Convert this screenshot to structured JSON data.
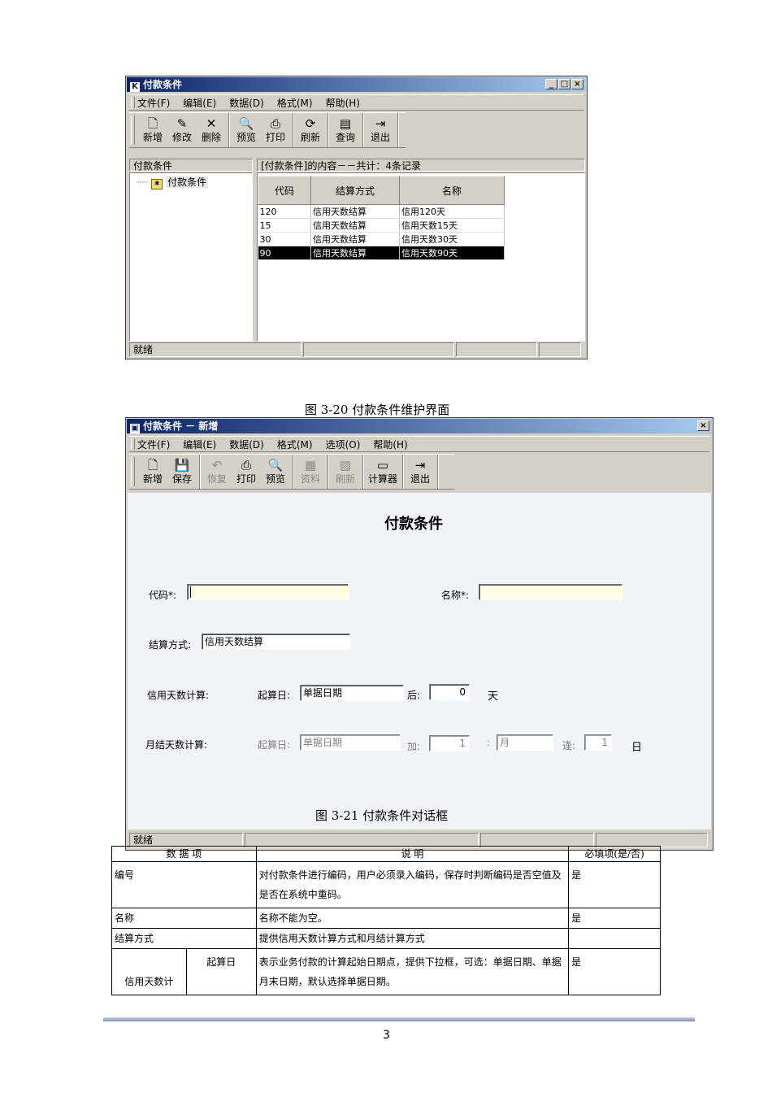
{
  "window1": {
    "title": "付款条件",
    "title_icon": "K",
    "window_buttons": [
      "_",
      "□",
      "×"
    ],
    "menu": [
      "文件(F)",
      "编辑(E)",
      "数据(D)",
      "格式(M)",
      "帮助(H)"
    ],
    "toolbar": [
      [
        {
          "icon": "new-icon",
          "glyph": "🗋",
          "label": "新增"
        },
        {
          "icon": "edit-icon",
          "glyph": "✎",
          "label": "修改"
        },
        {
          "icon": "delete-icon",
          "glyph": "✕",
          "label": "删除"
        }
      ],
      [
        {
          "icon": "preview-icon",
          "glyph": "🔍",
          "label": "预览"
        },
        {
          "icon": "print-icon",
          "glyph": "⎙",
          "label": "打印"
        }
      ],
      [
        {
          "icon": "refresh-icon",
          "glyph": "⟳",
          "label": "刷新"
        }
      ],
      [
        {
          "icon": "query-icon",
          "glyph": "▤",
          "label": "查询"
        }
      ],
      [
        {
          "icon": "exit-icon",
          "glyph": "⇥",
          "label": "退出"
        }
      ]
    ],
    "left_panel_title": "付款条件",
    "tree_item": "付款条件",
    "right_panel_title": "[付款条件]的内容－－共计：4条记录",
    "grid": {
      "columns": [
        "代码",
        "结算方式",
        "名称"
      ],
      "rows": [
        [
          "120",
          "信用天数结算",
          "信用120天"
        ],
        [
          "15",
          "信用天数结算",
          "信用天数15天"
        ],
        [
          "30",
          "信用天数结算",
          "信用天数30天"
        ],
        [
          "90",
          "信用天数结算",
          "信用天数90天"
        ]
      ],
      "selected_row": 3
    },
    "status": "就绪"
  },
  "caption1": "图 3-20 付款条件维护界面",
  "window2": {
    "title": "付款条件 － 新增",
    "close": "×",
    "menu": [
      "文件(F)",
      "编辑(E)",
      "数据(D)",
      "格式(M)",
      "选项(O)",
      "帮助(H)"
    ],
    "toolbar": [
      [
        {
          "icon": "new-icon",
          "glyph": "🗋",
          "label": "新增",
          "enabled": true
        },
        {
          "icon": "save-icon",
          "glyph": "💾",
          "label": "保存",
          "enabled": true
        }
      ],
      [
        {
          "icon": "undo-icon",
          "glyph": "↶",
          "label": "恢复",
          "enabled": false
        },
        {
          "icon": "print-icon",
          "glyph": "⎙",
          "label": "打印",
          "enabled": true
        },
        {
          "icon": "preview-icon",
          "glyph": "🔍",
          "label": "预览",
          "enabled": true
        }
      ],
      [
        {
          "icon": "info-icon",
          "glyph": "▦",
          "label": "资料",
          "enabled": false
        }
      ],
      [
        {
          "icon": "refresh-icon",
          "glyph": "▧",
          "label": "刷新",
          "enabled": false
        }
      ],
      [
        {
          "icon": "calculator-icon",
          "glyph": "▭",
          "label": "计算器",
          "enabled": true
        }
      ],
      [
        {
          "icon": "exit-icon",
          "glyph": "⇥",
          "label": "退出",
          "enabled": true
        }
      ]
    ],
    "form_title": "付款条件",
    "code_label": "代码*:",
    "code_value": "",
    "name_label": "名称*:",
    "name_value": "",
    "settle_label": "结算方式:",
    "settle_value": "信用天数结算",
    "credit_label": "信用天数计算:",
    "credit_start_label": "起算日:",
    "credit_start_value": "单据日期",
    "credit_after_label": "后:",
    "credit_days_value": "0",
    "credit_unit": "天",
    "month_label": "月结天数计算:",
    "month_start_label": "起算日:",
    "month_start_value": "单据日期",
    "month_add_label": "加:",
    "month_add_value": "1",
    "month_colon": ":",
    "month_unit_value": "月",
    "month_reach_label": "逢:",
    "month_reach_value": "1",
    "month_day_unit": "日",
    "status": "就绪"
  },
  "caption2": "图 3-21 付款条件对话框",
  "doc_table": {
    "headers": [
      "数 据 项",
      "说 明",
      "必填项(是/否)"
    ],
    "rows": [
      {
        "item": "编号",
        "desc": "对付款条件进行编码，用户必须录入编码，保存时判断编码是否空值及是否在系统中重码。",
        "req": "是"
      },
      {
        "item": "名称",
        "desc": "名称不能为空。",
        "req": "是"
      },
      {
        "item": "结算方式",
        "desc": "提供信用天数计算方式和月结计算方式",
        "req": ""
      }
    ],
    "last_row": {
      "group": "信用天数计",
      "sub": "起算日",
      "desc": "表示业务付款的计算起始日期点，提供下拉框，可选：单据日期、单据月末日期，默认选择单据日期。",
      "req": "是"
    }
  },
  "page_number": "3"
}
